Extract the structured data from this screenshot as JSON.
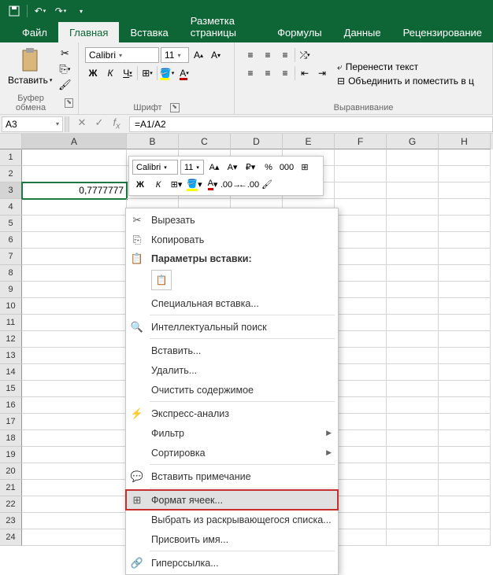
{
  "titlebar": {
    "save": "save-icon",
    "undo": "undo-icon",
    "redo": "redo-icon"
  },
  "tabs": {
    "file": "Файл",
    "home": "Главная",
    "insert": "Вставка",
    "layout": "Разметка страницы",
    "formulas": "Формулы",
    "data": "Данные",
    "review": "Рецензирование"
  },
  "ribbon": {
    "clipboard": {
      "paste": "Вставить",
      "label": "Буфер обмена"
    },
    "font": {
      "label": "Шрифт",
      "family": "Calibri",
      "size": "11",
      "bold": "Ж",
      "italic": "К",
      "underline": "Ч"
    },
    "align": {
      "label": "Выравнивание",
      "wrap": "Перенести текст",
      "merge": "Объединить и поместить в ц"
    }
  },
  "namebox": "A3",
  "formula": "=A1/A2",
  "columns": [
    "A",
    "B",
    "C",
    "D",
    "E",
    "F",
    "G",
    "H"
  ],
  "rows": [
    "1",
    "2",
    "3",
    "4",
    "5",
    "6",
    "7",
    "8",
    "9",
    "10",
    "11",
    "12",
    "13",
    "14",
    "15",
    "16",
    "17",
    "18",
    "19",
    "20",
    "21",
    "22",
    "23",
    "24"
  ],
  "cells": {
    "A3": "0,7777777"
  },
  "selected_cell": "A3",
  "minitoolbar": {
    "family": "Calibri",
    "size": "11",
    "bold": "Ж",
    "italic": "К"
  },
  "context_menu": {
    "cut": "Вырезать",
    "copy": "Копировать",
    "paste_header": "Параметры вставки:",
    "paste_special": "Специальная вставка...",
    "smart_lookup": "Интеллектуальный поиск",
    "insert": "Вставить...",
    "delete": "Удалить...",
    "clear": "Очистить содержимое",
    "quick_analysis": "Экспресс-анализ",
    "filter": "Фильтр",
    "sort": "Сортировка",
    "insert_comment": "Вставить примечание",
    "format_cells": "Формат ячеек...",
    "pick_from_list": "Выбрать из раскрывающегося списка...",
    "define_name": "Присвоить имя...",
    "hyperlink": "Гиперссылка..."
  }
}
